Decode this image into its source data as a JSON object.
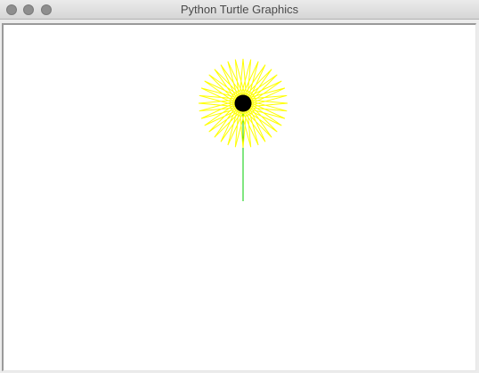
{
  "window": {
    "title": "Python Turtle Graphics"
  },
  "drawing": {
    "stem_color": "#00cc00",
    "petal_color": "#ffff00",
    "center_color": "#000000",
    "petal_count": 36,
    "petal_turn_degrees": 170
  }
}
